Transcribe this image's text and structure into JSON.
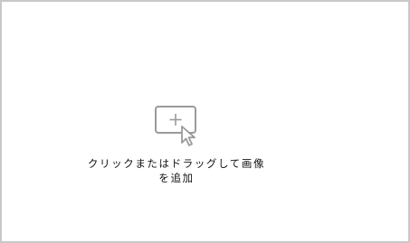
{
  "dropzone": {
    "icon": "image-add-cursor-icon",
    "hint_text": "クリックまたはドラッグして画像を追加",
    "border_color": "#c8c8c8",
    "icon_color": "#9a9a9a"
  }
}
